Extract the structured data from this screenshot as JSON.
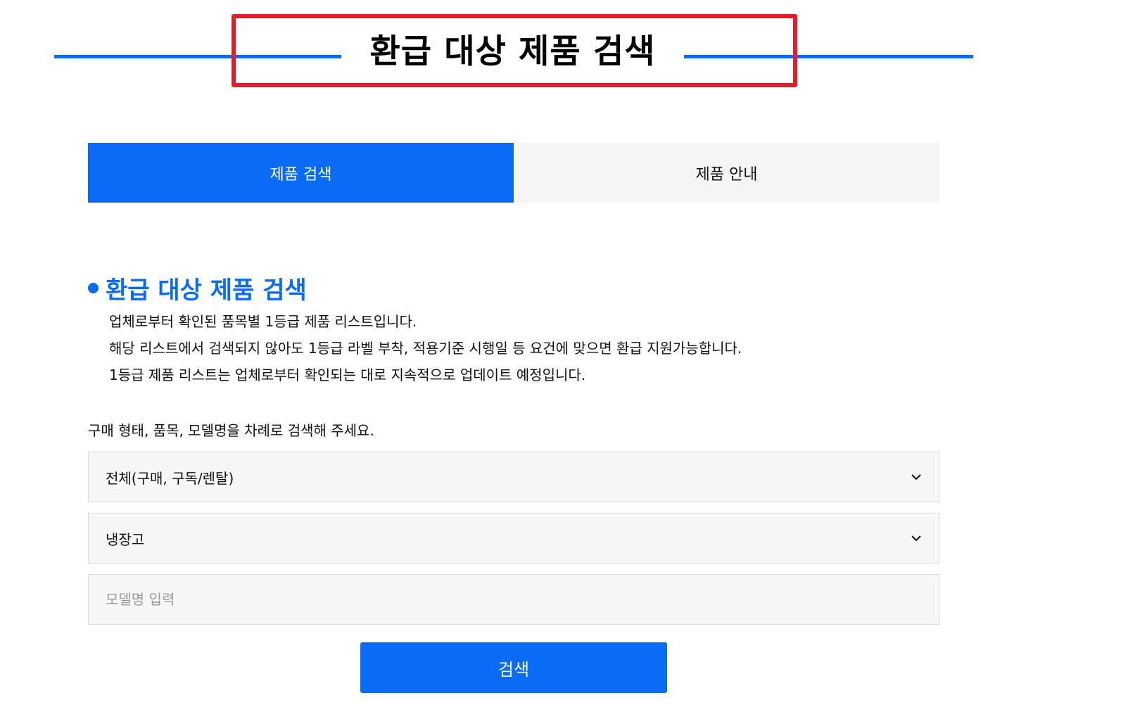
{
  "banner": {
    "title": "환급 대상 제품 검색"
  },
  "tabs": [
    {
      "label": "제품 검색",
      "active": true
    },
    {
      "label": "제품 안내",
      "active": false
    }
  ],
  "section": {
    "heading": "환급 대상 제품 검색",
    "description": [
      "업체로부터 확인된 품목별 1등급 제품 리스트입니다.",
      "해당 리스트에서 검색되지 않아도 1등급 라벨 부착, 적용기준 시행일 등 요건에 맞으면 환급 지원가능합니다.",
      "1등급 제품 리스트는 업체로부터 확인되는 대로 지속적으로 업데이트 예정입니다."
    ]
  },
  "form": {
    "instruction": "구매 형태, 품목, 모델명을 차례로 검색해 주세요.",
    "purchase_type": {
      "selected": "전체(구매, 구독/렌탈)"
    },
    "category": {
      "selected": "냉장고"
    },
    "model": {
      "value": "",
      "placeholder": "모델명 입력"
    },
    "search_label": "검색"
  },
  "colors": {
    "accent": "#0a6cf4",
    "highlight_box": "#e31e2a",
    "field_bg": "#f7f7f7",
    "tab_inactive_bg": "#f5f5f5"
  },
  "icons": {
    "select_arrow": "chevron-down-icon",
    "bullet": "bullet-dot-icon"
  }
}
